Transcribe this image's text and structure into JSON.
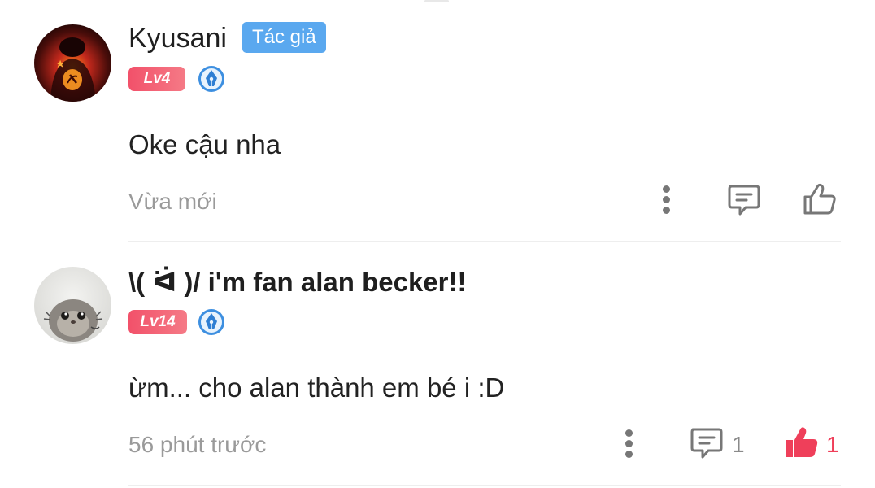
{
  "comments": [
    {
      "username": "Kyusani",
      "author_badge": "Tác giả",
      "level": "Lv4",
      "text": "Oke cậu nha",
      "timestamp": "Vừa mới",
      "reply_count": "",
      "like_count": "",
      "liked": false,
      "avatar_icon": "hammer-sickle-avatar"
    },
    {
      "username": "\\( ᐛ )/ i'm fan alan becker!!",
      "author_badge": "",
      "level": "Lv14",
      "text": "ừm... cho alan thành em bé i :D",
      "timestamp": "56 phút trước",
      "reply_count": "1",
      "like_count": "1",
      "liked": true,
      "avatar_icon": "hamster-avatar"
    }
  ],
  "colors": {
    "author_badge": "#5aa8ef",
    "level_badge": "#f2516a",
    "liked": "#ef3f5a",
    "icon_gray": "#777777",
    "muted_text": "#9a9a9a",
    "pen_badge": "#3d8fe0"
  },
  "icons": {
    "more": "more-vertical-icon",
    "reply": "comment-icon",
    "like": "thumbs-up-icon",
    "pen": "pen-nib-badge-icon"
  }
}
